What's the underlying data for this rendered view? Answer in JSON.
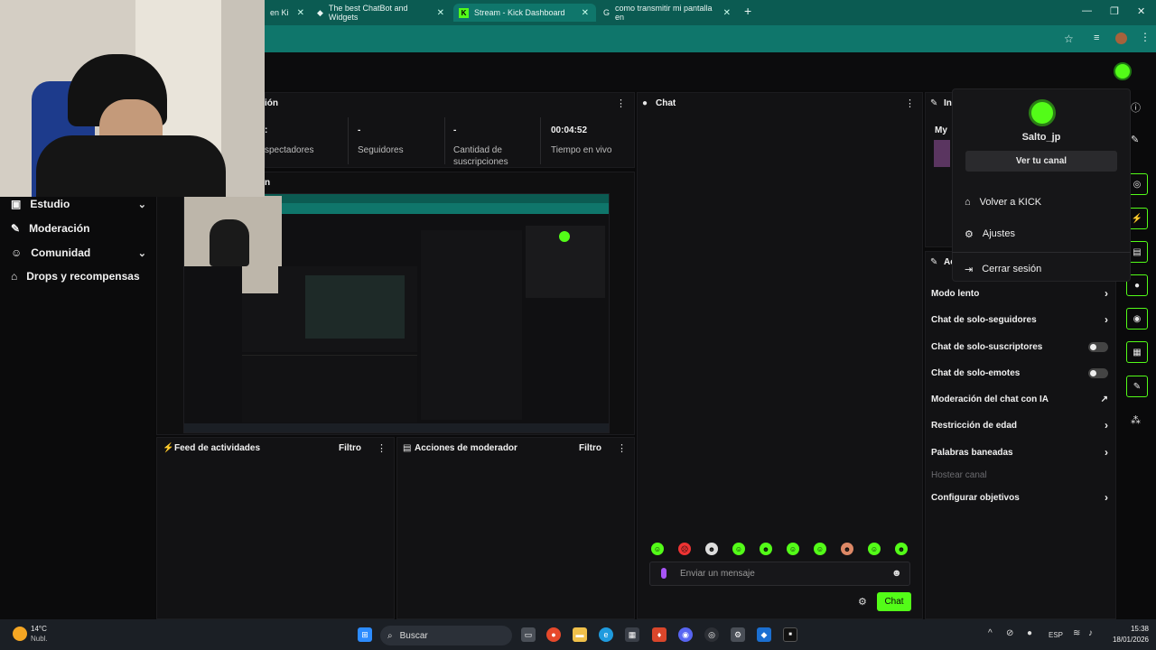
{
  "browser": {
    "tabs": [
      {
        "label": "en Ki"
      },
      {
        "label": "The best ChatBot and Widgets"
      },
      {
        "label": "Stream - Kick Dashboard"
      },
      {
        "label": "como transmitir mi pantalla en"
      }
    ],
    "new_tab": "+",
    "window_controls": {
      "minimize": "—",
      "maximize": "❐",
      "close": "✕"
    }
  },
  "sidebar": {
    "items": [
      {
        "label": "Estudio",
        "chevron": "⌄"
      },
      {
        "label": "Moderación"
      },
      {
        "label": "Comunidad",
        "chevron": "⌄"
      },
      {
        "label": "Drops y recompensas"
      }
    ]
  },
  "stats_panel": {
    "title": "ión",
    "stats": [
      {
        "value": ":",
        "label": "spectadores"
      },
      {
        "value": "-",
        "label": "Seguidores"
      },
      {
        "value": "-",
        "label": "Cantidad de suscripciones"
      },
      {
        "value": "00:04:52",
        "label": "Tiempo en vivo"
      }
    ]
  },
  "preview_panel": {
    "title": "n"
  },
  "activity_feed": {
    "title": "Feed de actividades",
    "filter": "Filtro"
  },
  "mod_actions": {
    "title": "Acciones de moderador",
    "filter": "Filtro"
  },
  "chat": {
    "title": "Chat",
    "input_placeholder": "Enviar un mensaje",
    "send_label": "Chat"
  },
  "info_panel": {
    "title_fragment": "In",
    "line": "My"
  },
  "actions_panel": {
    "title_fragment": "Ac"
  },
  "profile_menu": {
    "username": "Salto_jp",
    "view_channel": "Ver tu canal",
    "items": [
      {
        "label": "Volver a KICK",
        "icon": "home-icon"
      },
      {
        "label": "Ajustes",
        "icon": "gear-icon"
      },
      {
        "label": "Cerrar sesión",
        "icon": "logout-icon"
      }
    ]
  },
  "chat_settings": {
    "items": [
      {
        "label": "Modo lento",
        "control": "chevron"
      },
      {
        "label": "Chat de solo-seguidores",
        "control": "chevron"
      },
      {
        "label": "Chat de solo-suscriptores",
        "control": "toggle"
      },
      {
        "label": "Chat de solo-emotes",
        "control": "toggle"
      },
      {
        "label": "Moderación del chat con IA",
        "control": "external"
      },
      {
        "label": "Restricción de edad",
        "control": "chevron"
      },
      {
        "label": "Palabras baneadas",
        "control": "chevron"
      },
      {
        "label": "Hostear canal",
        "control": "disabled"
      },
      {
        "label": "Configurar objetivos",
        "control": "chevron"
      }
    ]
  },
  "taskbar": {
    "weather_temp": "14°C",
    "weather_desc": "Nubl.",
    "search": "Buscar",
    "lang": "ESP",
    "time": "15:38",
    "date": "18/01/2026"
  },
  "colors": {
    "accent": "#53fc18",
    "chrome": "#0f766b",
    "bg": "#0a0a0b"
  }
}
